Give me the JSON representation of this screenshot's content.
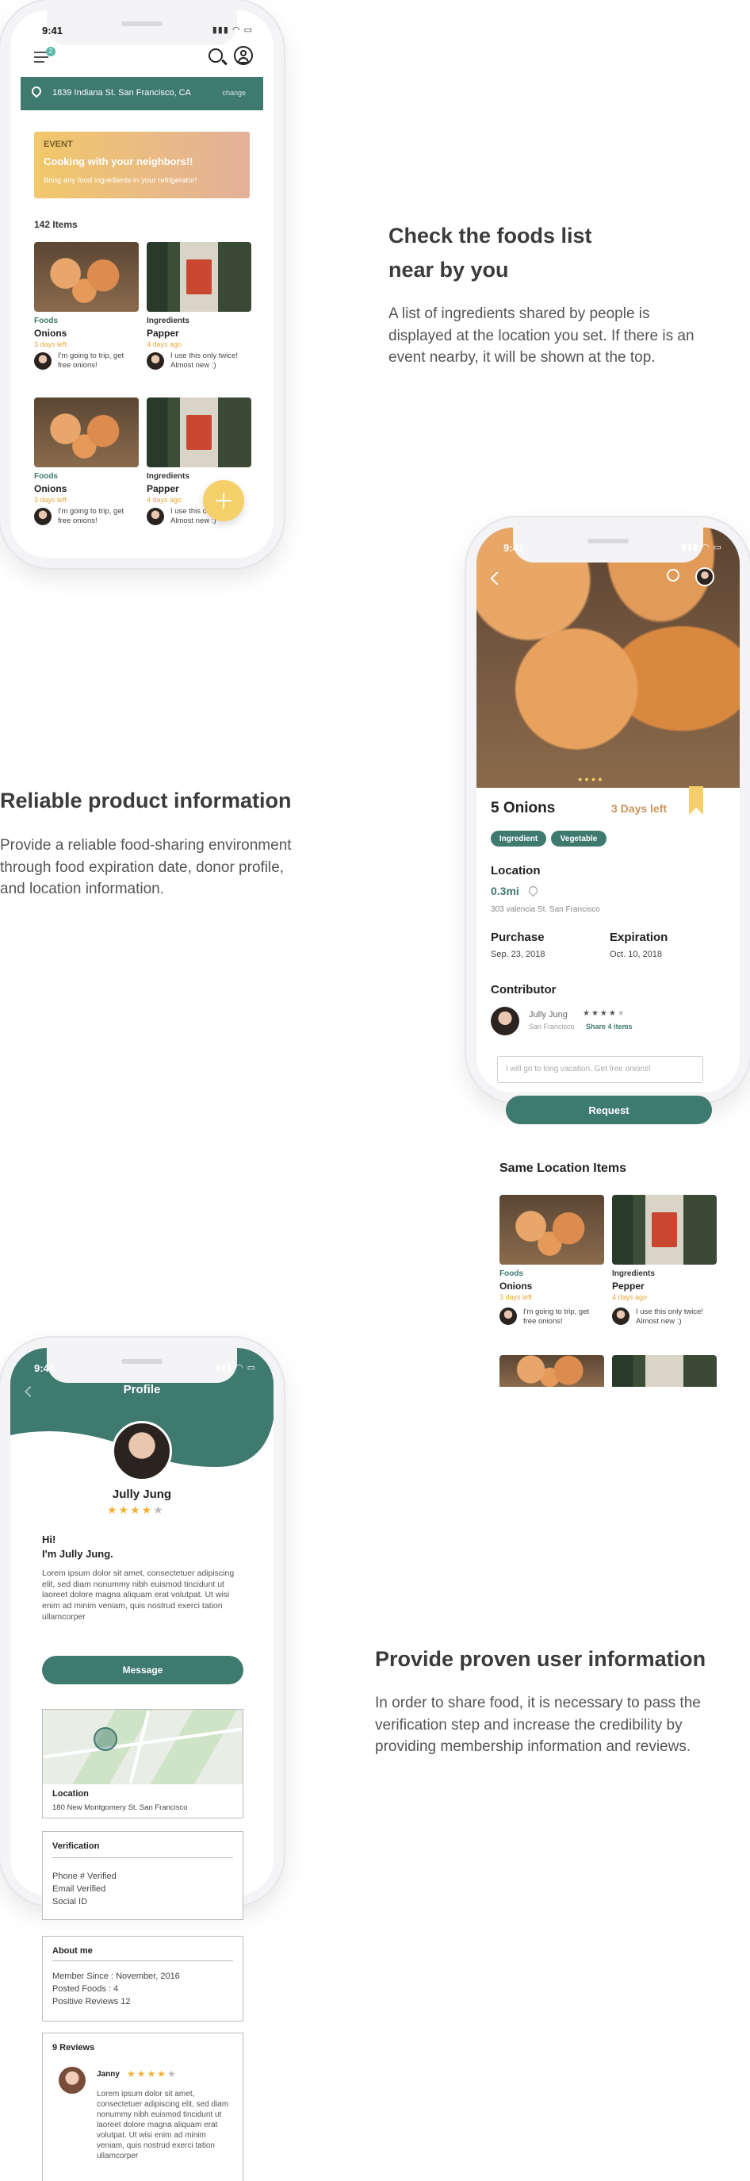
{
  "phone1": {
    "status_time": "9:41",
    "menu_badge": "2",
    "location": "1839 Indiana St. San Francisco, CA",
    "change_label": "change",
    "event": {
      "tag": "EVENT",
      "title": "Cooking with your neighbors!!",
      "subtitle": "Bring any food ingredients in your refrigerator!"
    },
    "items_count": "142 Items",
    "items": [
      {
        "category": "Foods",
        "name": "Onions",
        "days": "3 days left",
        "note": "I'm going to trip, get free onions!"
      },
      {
        "category": "Ingredients",
        "name": "Papper",
        "days": "4 days ago",
        "note": "I use this only twice! Almost new :)"
      },
      {
        "category": "Foods",
        "name": "Onions",
        "days": "3 days left",
        "note": "I'm going to trip, get free onions!"
      },
      {
        "category": "Ingredients",
        "name": "Papper",
        "days": "4 days ago",
        "note": "I use this only twice! Almost new :)"
      }
    ],
    "fab_icon": "plus-icon"
  },
  "section1": {
    "heading_line1": "Check the foods list",
    "heading_line2": "near by you",
    "text": "A list of ingredients shared by people is displayed at the location you set. If there is an event nearby, it will be shown at the top."
  },
  "section2": {
    "heading": "Reliable product information",
    "text": "Provide a reliable food-sharing environment through food expiration date, donor profile, and location information."
  },
  "phone2": {
    "status_time": "9:41",
    "title": "5 Onions",
    "days_left": "3 Days left",
    "tags": [
      "Ingredient",
      "Vegetable"
    ],
    "location_label": "Location",
    "distance": "0.3mi",
    "address": "303 valencia St. San Francisco",
    "purchase_label": "Purchase",
    "purchase_date": "Sep. 23, 2018",
    "expiration_label": "Expiration",
    "expiration_date": "Oct. 10, 2018",
    "contributor_label": "Contributor",
    "contributor_name": "Jully Jung",
    "contributor_city": "San Francisco",
    "contributor_rating": 4,
    "share_link": "Share 4 items",
    "message_placeholder": "I will go to long vacation. Get free onions!",
    "request_label": "Request",
    "same_location_label": "Same Location Items",
    "same_items": [
      {
        "category": "Foods",
        "name": "Onions",
        "days": "3 days left",
        "note": "I'm going to trip, get free onions!"
      },
      {
        "category": "Ingredients",
        "name": "Pepper",
        "days": "4 days ago",
        "note": "I use this only twice! Almost new :)"
      }
    ]
  },
  "section3": {
    "heading": "Provide proven user information",
    "text": "In order to share food, it is necessary to pass the verification step and increase the credibility by providing membership information and reviews."
  },
  "phone3": {
    "status_time": "9:41",
    "title": "Profile",
    "name": "Jully Jung",
    "rating": 4,
    "greeting_line1": "Hi!",
    "greeting_line2": "I'm Jully Jung.",
    "bio": "Lorem ipsum dolor sit amet, consectetuer adipiscing elit, sed diam nonummy nibh euismod tincidunt ut laoreet dolore magna aliquam erat volutpat. Ut wisi enim ad minim veniam, quis nostrud exerci tation ullamcorper",
    "message_label": "Message",
    "location_label": "Location",
    "location_address": "180 New Montgomery St. San Francisco",
    "verification_label": "Verification",
    "verification_items": [
      "Phone # Verified",
      "Email Verified",
      "Social ID"
    ],
    "about_label": "About me",
    "about_items": [
      "Member Since : November, 2016",
      "Posted Foods : 4",
      "Positive Reviews  12"
    ],
    "reviews_label": "9 Reviews",
    "reviewer_name": "Janny",
    "reviewer_rating": 4,
    "review_text": "Lorem ipsum dolor sit amet, consectetuer adipiscing elit, sed diam nonummy nibh euismod tincidunt ut laoreet dolore magna aliquam erat volutpat. Ut wisi enim ad minim veniam, quis nostrud exerci tation ullamcorper"
  },
  "colors": {
    "accent": "#3e7a6e",
    "orange": "#e8a63a",
    "event_from": "#f1c86a",
    "event_to": "#e3b09a"
  }
}
